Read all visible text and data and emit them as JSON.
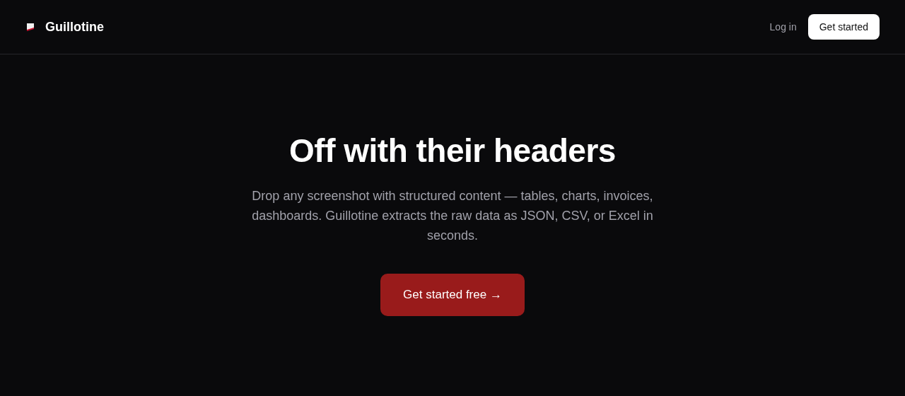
{
  "header": {
    "brand": "Guillotine",
    "login": "Log in",
    "cta": "Get started"
  },
  "hero": {
    "title": "Off with their headers",
    "subtitle": "Drop any screenshot with structured content — tables, charts, invoices, dashboards. Guillotine extracts the raw data as JSON, CSV, or Excel in seconds.",
    "button": "Get started free →"
  }
}
